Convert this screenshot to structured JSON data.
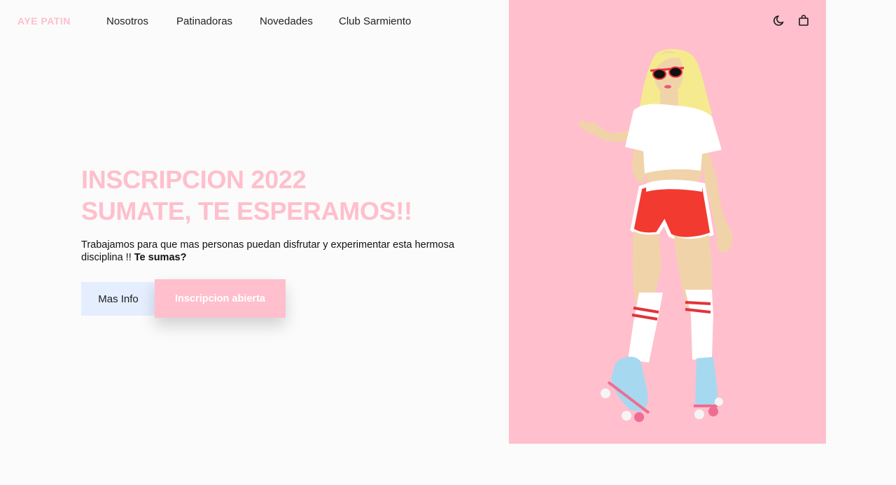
{
  "header": {
    "logo": "AYE PATIN",
    "nav": [
      {
        "label": "Nosotros"
      },
      {
        "label": "Patinadoras"
      },
      {
        "label": "Novedades"
      },
      {
        "label": "Club Sarmiento"
      }
    ],
    "icons": [
      "moon-icon",
      "shopping-bag-icon"
    ]
  },
  "hero": {
    "title_line1": "INSCRIPCION 2022",
    "title_line2": "SUMATE, TE ESPERAMOS!!",
    "description": "Trabajamos para que mas personas puedan disfrutar y experimentar esta hermosa disciplina !! ",
    "description_bold": "Te sumas?",
    "btn_info": "Mas Info",
    "btn_inscripcion": "Inscripcion abierta"
  },
  "colors": {
    "brand_pink": "#ffbfcc",
    "page_background": "#fbfbfb",
    "info_button_background": "#e4eefe",
    "text_dark": "#111111"
  },
  "illustration": {
    "subject": "roller-skater-girl",
    "icon": "roller-skater-illustration"
  }
}
